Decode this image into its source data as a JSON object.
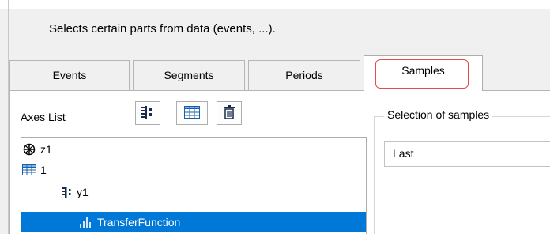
{
  "dialog": {
    "description": "Selects certain parts from data (events, ...)."
  },
  "tabs": [
    {
      "label": "Events",
      "active": false
    },
    {
      "label": "Segments",
      "active": false
    },
    {
      "label": "Periods",
      "active": false
    },
    {
      "label": "Samples",
      "active": true
    }
  ],
  "axes_list": {
    "label": "Axes List",
    "toolbar": [
      {
        "icon": "axis-stack-icon"
      },
      {
        "icon": "table-grid-icon"
      },
      {
        "icon": "trash-icon"
      }
    ],
    "items": [
      {
        "label": "z1",
        "icon": "crosshair-circle-icon",
        "selected": false
      },
      {
        "label": "1",
        "icon": "table-grid-icon",
        "selected": false
      },
      {
        "label": "y1",
        "icon": "axis-stack-icon",
        "selected": false
      },
      {
        "label": "TransferFunction",
        "icon": "bar-signal-icon",
        "selected": true
      }
    ]
  },
  "samples": {
    "group_title": "Selection of samples",
    "selection_value": "Last"
  },
  "colors": {
    "selection_bg": "#0078d7",
    "highlight_outline": "#e84a4f"
  }
}
